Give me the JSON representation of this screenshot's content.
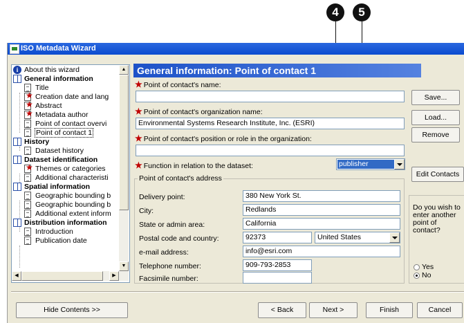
{
  "callouts": [
    "4",
    "5"
  ],
  "window": {
    "title": "ISO Metadata Wizard"
  },
  "tree": {
    "items": [
      {
        "label": "About this wizard",
        "icon": "info-icon"
      },
      {
        "label": "General information",
        "icon": "book-icon"
      },
      {
        "label": "Title",
        "icon": "page-icon"
      },
      {
        "label": "Creation date and lang",
        "icon": "required-page-icon"
      },
      {
        "label": "Abstract",
        "icon": "required-page-icon"
      },
      {
        "label": "Metadata author",
        "icon": "required-page-icon"
      },
      {
        "label": "Point of contact overvi",
        "icon": "page-icon"
      },
      {
        "label": "Point of contact 1",
        "icon": "page-icon"
      },
      {
        "label": "History",
        "icon": "book-icon"
      },
      {
        "label": "Dataset history",
        "icon": "page-icon"
      },
      {
        "label": "Dataset identification",
        "icon": "book-icon"
      },
      {
        "label": "Themes or categories",
        "icon": "required-page-icon"
      },
      {
        "label": "Additional characteristi",
        "icon": "page-icon"
      },
      {
        "label": "Spatial information",
        "icon": "book-icon"
      },
      {
        "label": "Geographic bounding b",
        "icon": "page-icon"
      },
      {
        "label": "Geographic bounding b",
        "icon": "page-icon"
      },
      {
        "label": "Additional extent inform",
        "icon": "page-icon"
      },
      {
        "label": "Distribution information",
        "icon": "book-icon"
      },
      {
        "label": "Introduction",
        "icon": "page-icon"
      },
      {
        "label": "Publication date",
        "icon": "page-icon"
      }
    ]
  },
  "header": {
    "title": "General information: Point of contact 1"
  },
  "form": {
    "name_label": "Point of contact's name:",
    "name_value": "",
    "org_label": "Point of contact's organization name:",
    "org_value": "Environmental Systems Research Institute, Inc. (ESRI)",
    "position_label": "Point of contact's position or role in the organization:",
    "position_value": "",
    "function_label": "Function in relation to the dataset:",
    "function_value": "publisher"
  },
  "address": {
    "group_title": "Point of contact's address",
    "delivery_label": "Delivery point:",
    "delivery_value": "380 New York St.",
    "city_label": "City:",
    "city_value": "Redlands",
    "state_label": "State or admin area:",
    "state_value": "California",
    "postal_label": "Postal code and country:",
    "postal_value": "92373",
    "country_value": "United States",
    "email_label": "e-mail address:",
    "email_value": "info@esri.com",
    "phone_label": "Telephone number:",
    "phone_value": "909-793-2853",
    "fax_label": "Facsimile number:",
    "fax_value": ""
  },
  "side_buttons": {
    "save": "Save...",
    "load": "Load...",
    "remove": "Remove",
    "edit_contacts": "Edit Contacts"
  },
  "another": {
    "question": "Do you wish to enter another point of contact?",
    "yes": "Yes",
    "no": "No",
    "selected": "No"
  },
  "footer": {
    "hide_contents": "Hide Contents >>",
    "back": "< Back",
    "next": "Next >",
    "finish": "Finish",
    "cancel": "Cancel"
  }
}
